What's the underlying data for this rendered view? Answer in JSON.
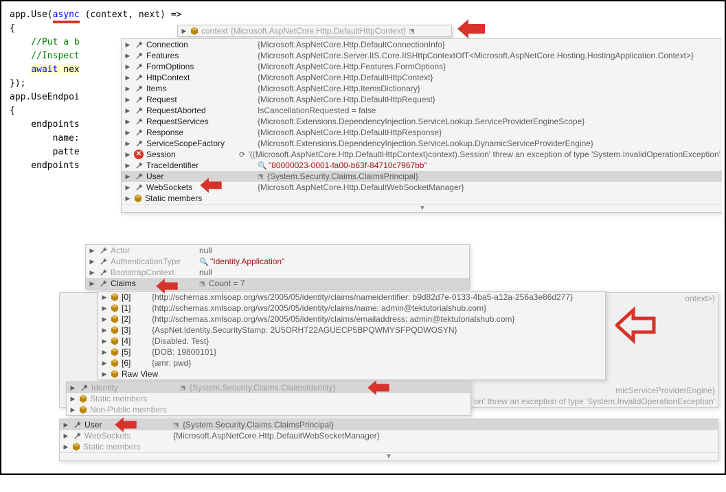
{
  "code": {
    "l1a": "app.Use(",
    "l1b": "async",
    "l1c": " (context, next) =>",
    "l2": "{",
    "l3": "    //Put a b",
    "l4": "    //Inspect",
    "l5a": "    ",
    "l5b": "await",
    "l5c": " nex",
    "l6": "});",
    "l7": "",
    "l8": "app.UseEndpoi",
    "l9": "{",
    "l10": "    endpoints",
    "l11": "        name:",
    "l12": "        patte",
    "l13": "    endpoints"
  },
  "tip_header": {
    "var": "context",
    "val": "{Microsoft.AspNetCore.Http.DefaultHttpContext}"
  },
  "top_props": [
    {
      "n": "Connection",
      "v": "{Microsoft.AspNetCore.Http.DefaultConnectionInfo}",
      "icon": "wrench"
    },
    {
      "n": "Features",
      "v": "{Microsoft.AspNetCore.Server.IIS.Core.IISHttpContextOfT<Microsoft.AspNetCore.Hosting.HostingApplication.Context>}",
      "icon": "wrench"
    },
    {
      "n": "FormOptions",
      "v": "{Microsoft.AspNetCore.Http.Features.FormOptions}",
      "icon": "wrench"
    },
    {
      "n": "HttpContext",
      "v": "{Microsoft.AspNetCore.Http.DefaultHttpContext}",
      "icon": "wrench"
    },
    {
      "n": "Items",
      "v": "{Microsoft.AspNetCore.Http.ItemsDictionary}",
      "icon": "wrench"
    },
    {
      "n": "Request",
      "v": "{Microsoft.AspNetCore.Http.DefaultHttpRequest}",
      "icon": "wrench"
    },
    {
      "n": "RequestAborted",
      "v": "IsCancellationRequested = false",
      "icon": "wrench"
    },
    {
      "n": "RequestServices",
      "v": "{Microsoft.Extensions.DependencyInjection.ServiceLookup.ServiceProviderEngineScope}",
      "icon": "wrench"
    },
    {
      "n": "Response",
      "v": "{Microsoft.AspNetCore.Http.DefaultHttpResponse}",
      "icon": "wrench"
    },
    {
      "n": "ServiceScopeFactory",
      "v": "{Microsoft.Extensions.DependencyInjection.ServiceLookup.DynamicServiceProviderEngine}",
      "icon": "wrench"
    },
    {
      "n": "Session",
      "v": "'((Microsoft.AspNetCore.Http.DefaultHttpContext)context).Session' threw an exception of type 'System.InvalidOperationException'",
      "icon": "error",
      "refresh": true
    },
    {
      "n": "TraceIdentifier",
      "v": "\"80000023-0001-fa00-b63f-84710c7967bb\"",
      "icon": "wrench",
      "mag": true,
      "quoted": true
    },
    {
      "n": "User",
      "v": "{System.Security.Claims.ClaimsPrincipal}",
      "icon": "wrench",
      "selected": true
    },
    {
      "n": "WebSockets",
      "v": "{Microsoft.AspNetCore.Http.DefaultWebSocketManager}",
      "icon": "wrench"
    },
    {
      "n": "Static members",
      "v": "",
      "icon": "cube"
    }
  ],
  "user_head": [
    {
      "n": "Actor",
      "v": "null",
      "icon": "wrench"
    },
    {
      "n": "AuthenticationType",
      "v": "\"Identity.Application\"",
      "icon": "wrench",
      "mag": true,
      "quoted": true
    },
    {
      "n": "BootstrapContext",
      "v": "null",
      "icon": "wrench"
    }
  ],
  "claims_row": {
    "n": "Claims",
    "v": "Count = 7"
  },
  "claims": [
    {
      "idx": "[0]",
      "v": "{http://schemas.xmlsoap.org/ws/2005/05/identity/claims/nameidentifier: b9d82d7e-0133-4ba5-a12a-256a3e86d277}"
    },
    {
      "idx": "[1]",
      "v": "{http://schemas.xmlsoap.org/ws/2005/05/identity/claims/name: admin@tektutorialshub.com}"
    },
    {
      "idx": "[2]",
      "v": "{http://schemas.xmlsoap.org/ws/2005/05/identity/claims/emailaddress: admin@tektutorialshub.com}"
    },
    {
      "idx": "[3]",
      "v": "{AspNet.Identity.SecurityStamp: 2U5ORHT22AGUECP5BPQWMYSFPQDWOSYN}"
    },
    {
      "idx": "[4]",
      "v": "{Disabled: Test}"
    },
    {
      "idx": "[5]",
      "v": "{DOB: 19800101}"
    },
    {
      "idx": "[6]",
      "v": "{amr: pwd}"
    }
  ],
  "raw_view": "Raw View",
  "bg_frag_top": "ontext>}",
  "bg_frag_mid1": "micServiceProviderEngine}",
  "bg_frag_mid2": "on' threw an exception of type 'System.InvalidOperationException'",
  "identity_row": {
    "n": "Identity",
    "v": "{System.Security.Claims.ClaimsIdentity}"
  },
  "static_members": "Static members",
  "nonpublic_members": "Non-Public members",
  "user_row": {
    "n": "User",
    "v": "{System.Security.Claims.ClaimsPrincipal}"
  },
  "websockets_row": {
    "n": "WebSockets",
    "v": "{Microsoft.AspNetCore.Http.DefaultWebSocketManager}"
  }
}
